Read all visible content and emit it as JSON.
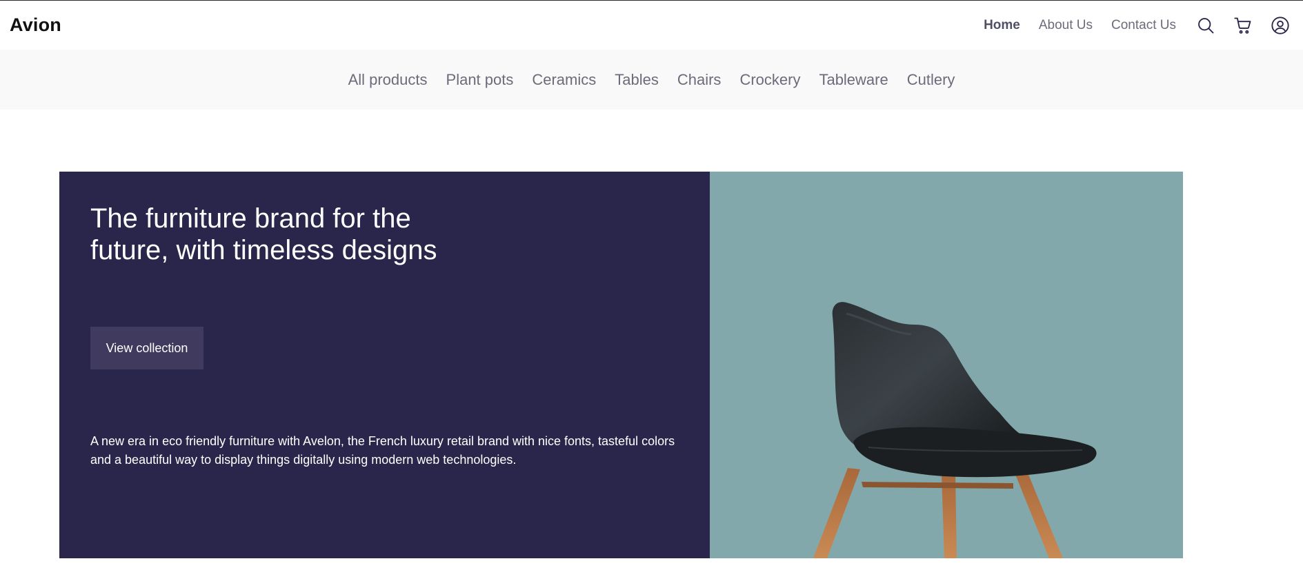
{
  "header": {
    "logo": "Avion",
    "nav": [
      {
        "label": "Home",
        "active": true
      },
      {
        "label": "About Us",
        "active": false
      },
      {
        "label": "Contact Us",
        "active": false
      }
    ],
    "icons": [
      "search-icon",
      "cart-icon",
      "user-icon"
    ]
  },
  "categories": [
    "All products",
    "Plant pots",
    "Ceramics",
    "Tables",
    "Chairs",
    "Crockery",
    "Tableware",
    "Cutlery"
  ],
  "hero": {
    "title": "The furniture brand for the future, with timeless designs",
    "button_label": "View collection",
    "description": "A new era in eco friendly furniture with Avelon, the French luxury retail brand with nice fonts, tasteful colors and a beautiful way to display things digitally using modern web technologies.",
    "image": "chair-photo"
  },
  "colors": {
    "primary": "#2A254B",
    "button": "#403A5F",
    "image_bg": "#83A8AB",
    "category_bar": "#F9F9F9",
    "nav_text": "#6B6B7B"
  }
}
